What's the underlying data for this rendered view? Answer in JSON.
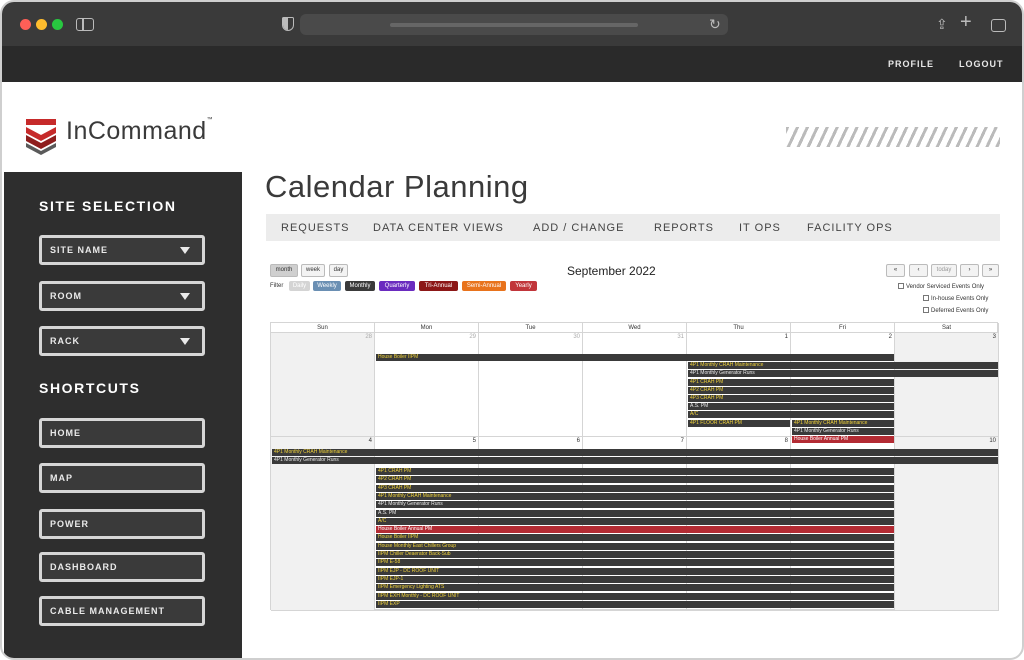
{
  "topbar": {
    "profile": "PROFILE",
    "logout": "LOGOUT"
  },
  "brand": {
    "name": "InCommand",
    "tm": "™"
  },
  "sidebar": {
    "site_selection_heading": "SITE SELECTION",
    "selects": [
      "SITE NAME",
      "ROOM",
      "RACK"
    ],
    "shortcuts_heading": "SHORTCUTS",
    "shortcuts": [
      "HOME",
      "MAP",
      "POWER",
      "DASHBOARD",
      "CABLE MANAGEMENT"
    ]
  },
  "page": {
    "title": "Calendar Planning"
  },
  "menu": [
    "REQUESTS",
    "DATA CENTER VIEWS",
    "ADD / CHANGE",
    "REPORTS",
    "IT OPS",
    "FACILITY OPS"
  ],
  "calendar": {
    "views": [
      "month",
      "week",
      "day"
    ],
    "title": "September 2022",
    "nav": [
      "«",
      "‹",
      "today",
      "›",
      "»"
    ],
    "filter_label": "Filter",
    "filters": [
      {
        "label": "Daily",
        "color": "#d4d4d4"
      },
      {
        "label": "Weekly",
        "color": "#6a8fb3"
      },
      {
        "label": "Monthly",
        "color": "#3a3a3a"
      },
      {
        "label": "Quarterly",
        "color": "#6a2bbf"
      },
      {
        "label": "Tri-Annual",
        "color": "#8c1717"
      },
      {
        "label": "Semi-Annual",
        "color": "#e8731c"
      },
      {
        "label": "Yearly",
        "color": "#c1353a"
      }
    ],
    "checkboxes": [
      "Vendor Serviced Events Only",
      "In-house Events Only",
      "Deferred Events Only"
    ],
    "day_names": [
      "Sun",
      "Mon",
      "Tue",
      "Wed",
      "Thu",
      "Fri",
      "Sat"
    ],
    "week1_dates": [
      "28",
      "29",
      "30",
      "31",
      "1",
      "2",
      "3"
    ],
    "week2_dates": [
      "4",
      "5",
      "6",
      "7",
      "8",
      "9",
      "10"
    ],
    "week1_events": [
      "House Boiler IIPM",
      "4P1 Monthly CRAH Maintenance",
      "4P1 Monthly Generator Runs",
      "4P1 CRAH PM",
      "4P2 CRAH PM",
      "4P3 CRAH PM",
      "A.S. PM",
      "A/C",
      "4P1 FLOOR CRAH PM",
      "4P1 Monthly CRAH Maintenance",
      "4P1 Monthly Generator Runs",
      "House Boiler Annual PM"
    ],
    "week2_events": [
      "4P1 Monthly CRAH Maintenance",
      "4P1 Monthly Generator Runs",
      "4P1 CRAH PM",
      "4P2 CRAH PM",
      "4P3 CRAH PM",
      "4P1 Monthly CRAH Maintenance",
      "4P1 Monthly Generator Runs",
      "A.S. PM",
      "A/C",
      "House Boiler Annual PM",
      "House Boiler IIPM",
      "House Monthly East Chillers Group",
      "IIPM Chiller Deaerator Back-Sub",
      "IIPM E-58",
      "IIPM EJP - DC ROOF UNIT",
      "IIPM EJP-1",
      "IIPM Emergency Lighting ATS",
      "IIPM EXH Monthly - DC ROOF UNIT",
      "IIPM EXP"
    ]
  }
}
